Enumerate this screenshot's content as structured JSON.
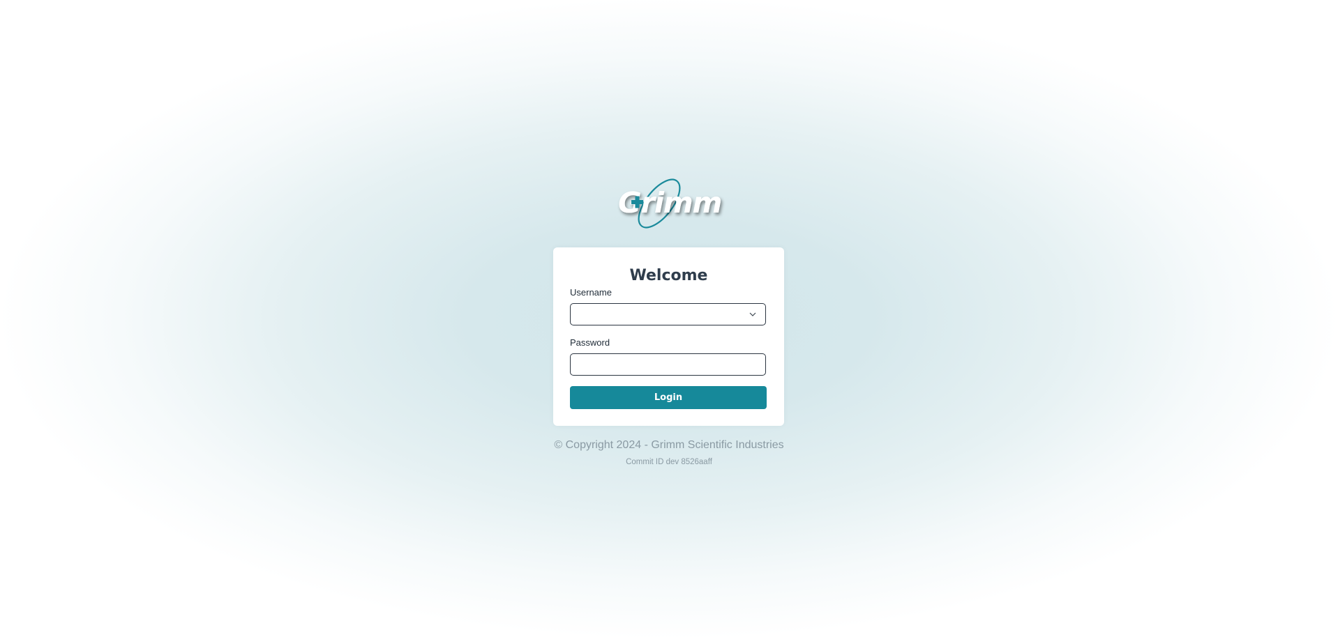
{
  "logo": {
    "text": "Grimm",
    "accent_color": "#1a8a9b"
  },
  "login_card": {
    "title": "Welcome",
    "username": {
      "label": "Username",
      "value": "",
      "icon": "chevron-down-icon"
    },
    "password": {
      "label": "Password",
      "value": ""
    },
    "login_button": {
      "label": "Login",
      "color": "#16899a"
    }
  },
  "footer": {
    "copyright": "© Copyright 2024 - Grimm Scientific Industries",
    "commit": "Commit ID dev 8526aaff"
  }
}
